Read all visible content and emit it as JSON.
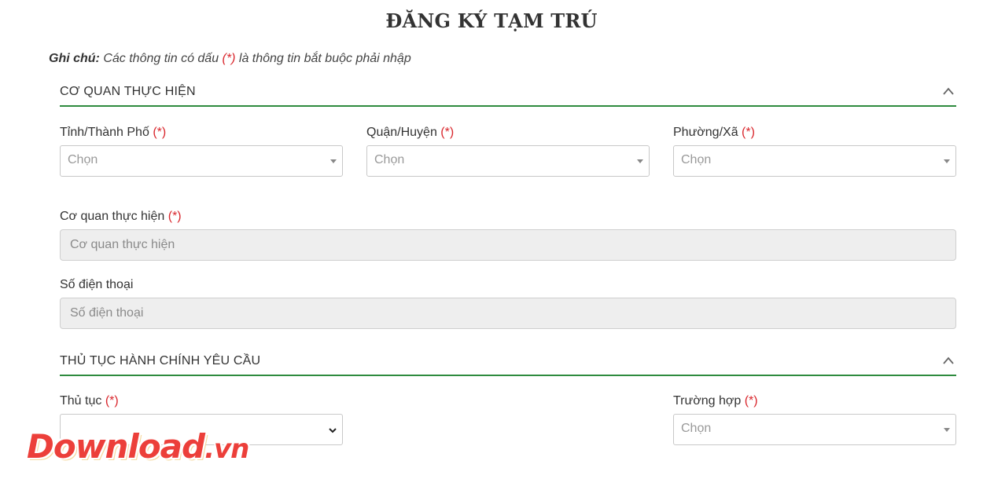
{
  "page": {
    "title": "ĐĂNG KÝ TẠM TRÚ",
    "note_label": "Ghi chú:",
    "note_text_before": " Các thông tin có dấu ",
    "note_required_marker": "(*)",
    "note_text_after": " là thông tin bắt buộc phải nhập"
  },
  "required_marker": "(*)",
  "section_agency": {
    "title": "CƠ QUAN THỰC HIỆN",
    "province": {
      "label": "Tỉnh/Thành Phố",
      "value": "Chọn"
    },
    "district": {
      "label": "Quận/Huyện",
      "value": "Chọn"
    },
    "ward": {
      "label": "Phường/Xã",
      "value": "Chọn"
    },
    "agency": {
      "label": "Cơ quan thực hiện",
      "placeholder": "Cơ quan thực hiện"
    },
    "phone": {
      "label": "Số điện thoại",
      "placeholder": "Số điện thoại"
    }
  },
  "section_procedure": {
    "title": "THỦ TỤC HÀNH CHÍNH YÊU CẦU",
    "procedure": {
      "label": "Thủ tục",
      "value": ""
    },
    "case": {
      "label": "Trường hợp",
      "value": "Chọn"
    }
  },
  "watermark": {
    "main": "Download",
    "ext": ".vn"
  },
  "colors": {
    "accent_green": "#2e8b3e",
    "required_red": "#d9262c",
    "watermark_red": "#ec3f3a"
  },
  "icons": {
    "collapse": "chevron-up-icon",
    "dropdown": "caret-down-icon",
    "native_dropdown": "chevron-down-icon"
  }
}
